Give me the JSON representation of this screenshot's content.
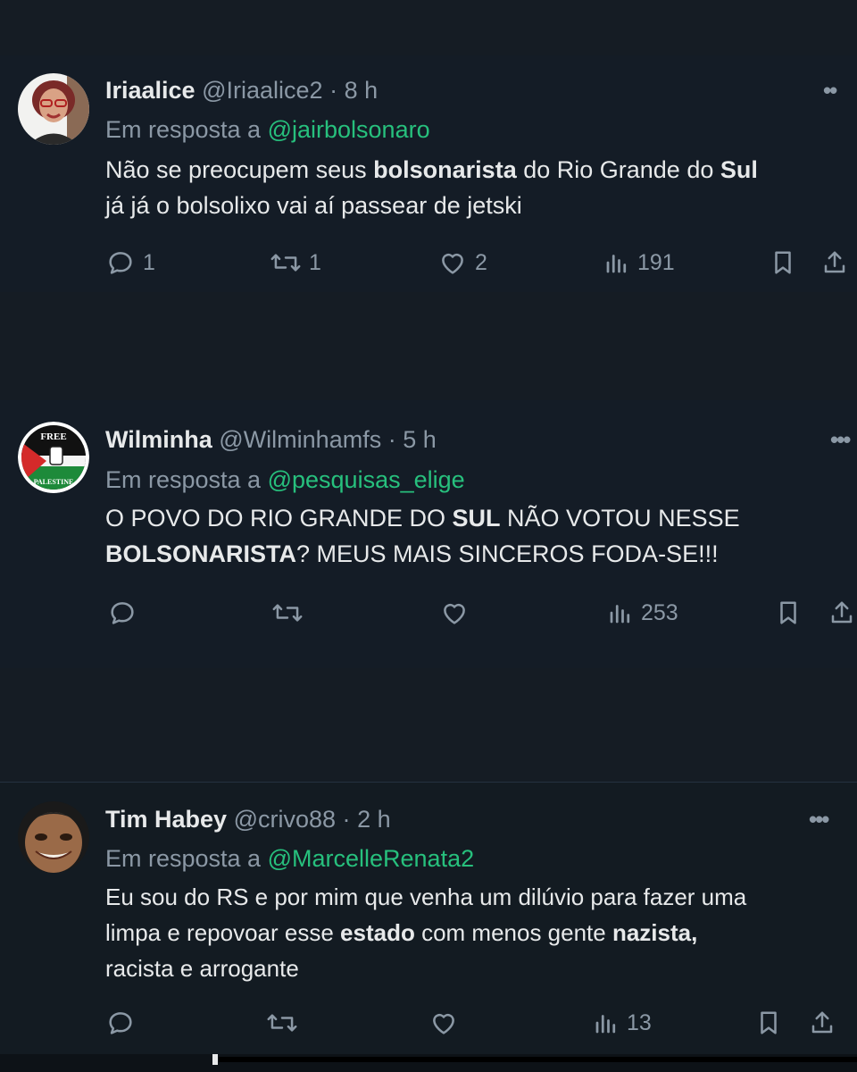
{
  "tweets": [
    {
      "name": "Iriaalice",
      "handle": "@Iriaalice2",
      "time": "8 h",
      "reply_prefix": "Em resposta a",
      "reply_to": "@jairbolsonaro",
      "text_parts": [
        "Não se preocupem seus ",
        "bolsonarista",
        " do Rio Grande do ",
        "Sul",
        "já já o bolsolixo vai aí passear de jetski"
      ],
      "replies": "1",
      "retweets": "1",
      "likes": "2",
      "views": "191"
    },
    {
      "name": "Wilminha",
      "handle": "@Wilminhamfs",
      "time": "5 h",
      "reply_prefix": "Em resposta a",
      "reply_to": "@pesquisas_elige",
      "text_parts": [
        "O POVO DO RIO GRANDE DO ",
        "SUL",
        " NÃO VOTOU NESSE",
        "BOLSONARISTA",
        "? MEUS MAIS SINCEROS FODA-SE!!!"
      ],
      "replies": "",
      "retweets": "",
      "likes": "",
      "views": "253",
      "avatar_text_top": "FREE",
      "avatar_text_bottom": "PALESTINE"
    },
    {
      "name": "Tim Habey",
      "handle": "@crivo88",
      "time": "2 h",
      "reply_prefix": "Em resposta a",
      "reply_to": "@MarcelleRenata2",
      "text_parts": [
        "Eu sou do RS e por mim que venha um dilúvio para fazer uma",
        "limpa e repovoar esse ",
        "estado",
        " com menos gente ",
        "nazista",
        ",",
        "racista e arrogante"
      ],
      "replies": "",
      "retweets": "",
      "likes": "",
      "views": "13"
    }
  ],
  "separator": "·",
  "icons": {
    "reply": "reply-icon",
    "retweet": "retweet-icon",
    "like": "heart-icon",
    "views": "views-chart-icon",
    "bookmark": "bookmark-icon",
    "share": "share-icon",
    "more": "more-icon"
  },
  "colors": {
    "background": "#141c26",
    "text": "#e7e9ea",
    "muted": "#8b98a5",
    "mention": "#27c07d"
  }
}
